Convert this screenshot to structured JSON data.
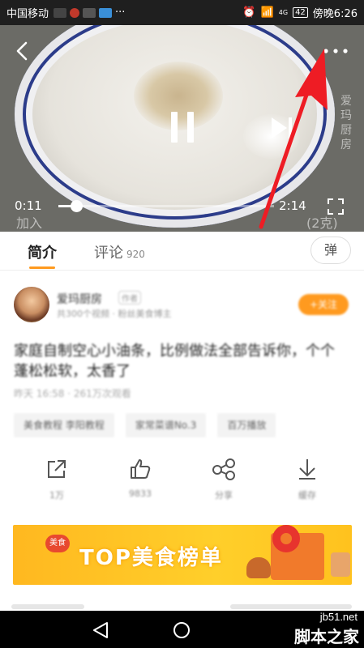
{
  "status_bar": {
    "carrier": "中国移动",
    "more": "···",
    "network": "4G",
    "battery": "42",
    "time": "傍晚6:26"
  },
  "video": {
    "current_time": "0:11",
    "duration": "2:14",
    "progress": 0.082,
    "overlay_left": "加入",
    "overlay_right": "(2克)",
    "watermark": "爱玛厨房"
  },
  "tabs": {
    "intro": "简介",
    "comments": "评论",
    "comments_count": "920",
    "danmu": "弹"
  },
  "author": {
    "name": "爱玛厨房",
    "tag": "作者",
    "subtitle": "共300个视频 · 粉丝美食博主",
    "follow": "+关注"
  },
  "recipe": {
    "title": "家庭自制空心小油条，比例做法全部告诉你，个个蓬松松软，太香了",
    "meta": "昨天 16:58 · 261万次观看"
  },
  "tags": [
    "美食教程 李阳教程",
    "家常菜谱No.3",
    "百万播放"
  ],
  "actions": {
    "share": "1万",
    "like": "9833",
    "forward": "分享",
    "download": "缓存"
  },
  "banner": {
    "badge": "美食",
    "text": "TOP美食榜单"
  },
  "site_watermark": {
    "url": "jb51.net",
    "name": "脚本之家"
  }
}
